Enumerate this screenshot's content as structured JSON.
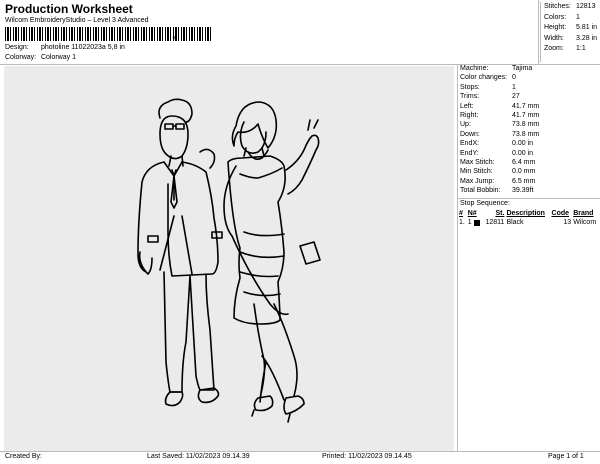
{
  "header": {
    "title": "Production Worksheet",
    "subtitle": "Wilcom EmbroideryStudio – Level 3 Advanced",
    "barcode_mark": ",",
    "design_label": "Design:",
    "design_value": "photoline 11022023a 5,8 in",
    "colorway_label": "Colorway:",
    "colorway_value": "Colorway 1"
  },
  "stats": [
    {
      "label": "Stitches:",
      "value": "12813"
    },
    {
      "label": "Colors:",
      "value": "1"
    },
    {
      "label": "Height:",
      "value": "5.81 in"
    },
    {
      "label": "Width:",
      "value": "3.28 in"
    },
    {
      "label": "Zoom:",
      "value": "1:1"
    }
  ],
  "machine": [
    {
      "label": "Machine:",
      "value": "Tajima"
    },
    {
      "label": "Color changes:",
      "value": "0"
    },
    {
      "label": "Stops:",
      "value": "1"
    },
    {
      "label": "Trims:",
      "value": "27"
    },
    {
      "label": "Left:",
      "value": "41.7 mm"
    },
    {
      "label": "Right:",
      "value": "41.7 mm"
    },
    {
      "label": "Up:",
      "value": "73.8 mm"
    },
    {
      "label": "Down:",
      "value": "73.8 mm"
    },
    {
      "label": "EndX:",
      "value": "0.00 in"
    },
    {
      "label": "EndY:",
      "value": "0.00 in"
    },
    {
      "label": "Max Stitch:",
      "value": "6.4 mm"
    },
    {
      "label": "Min Stitch:",
      "value": "0.0 mm"
    },
    {
      "label": "Max Jump:",
      "value": "6.5 mm"
    },
    {
      "label": "Total Bobbin:",
      "value": "39.39ft"
    }
  ],
  "stop_sequence": {
    "title": "Stop Sequence:",
    "headers": [
      "#",
      "N#",
      "St.",
      "Description",
      "Code",
      "Brand"
    ],
    "rows": [
      {
        "num": "1.",
        "n": "1",
        "st": "12811",
        "description": "Black",
        "code": "13",
        "brand": "Wilcom",
        "color": "#000000"
      }
    ]
  },
  "footer": {
    "created": "Created By:",
    "saved": "Last Saved: 11/02/2023 09.14.39",
    "printed": "Printed: 11/02/2023 09.14.45",
    "page": "Page 1 of 1"
  },
  "colors": {
    "canvas_bg": "#ebebeb",
    "line": "#bbbbbb",
    "stitch": "#000000"
  }
}
